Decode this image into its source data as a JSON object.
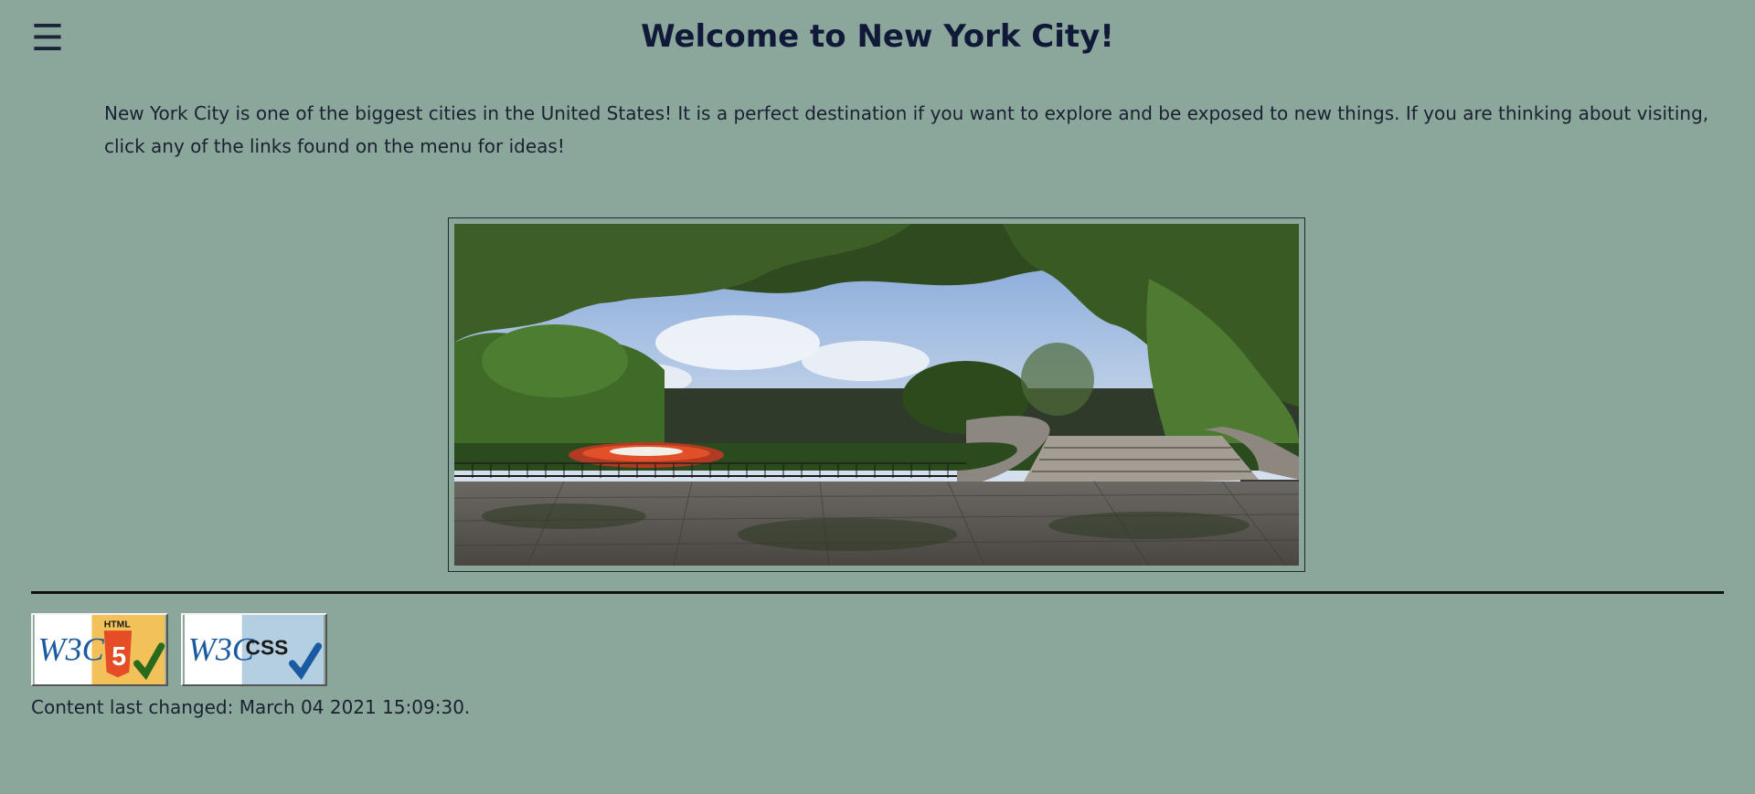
{
  "header": {
    "menu_icon": "hamburger-icon",
    "menu_glyph": "☰",
    "title": "Welcome to New York City!"
  },
  "main": {
    "intro": "New York City is one of the biggest cities in the United States! It is a perfect destination if you want to explore and be exposed to new things. If you are thinking about visiting, click any of the links found on the menu for ideas!"
  },
  "footer": {
    "badges": [
      {
        "icon": "w3c-html5-valid-badge",
        "mark": "W3C",
        "label": "HTML",
        "digit": "5"
      },
      {
        "icon": "w3c-css-valid-badge",
        "mark": "W3C",
        "label": "CSS"
      }
    ],
    "last_changed": "Content last changed: March 04 2021 15:09:30."
  },
  "colors": {
    "background": "#8ba69b",
    "title": "#101a38",
    "text": "#1a2130",
    "html5_orange": "#e44d26",
    "css_blue": "#1a5aa0",
    "check_green": "#2a6a1c"
  }
}
